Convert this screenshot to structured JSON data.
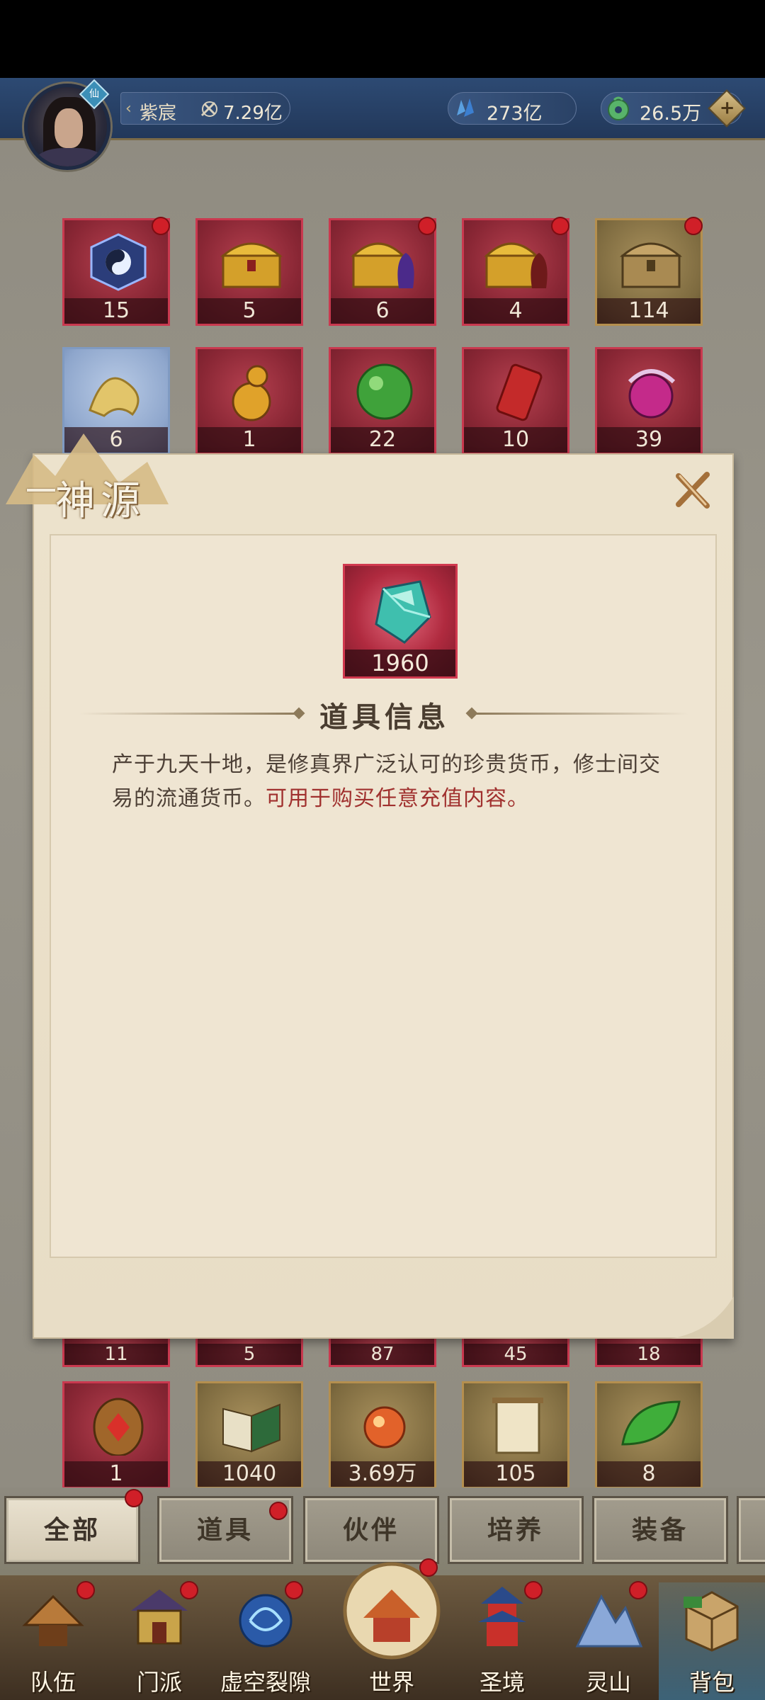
{
  "player": {
    "name": "紫宸",
    "vip_badge": "仙",
    "power": "7.29亿"
  },
  "currencies": [
    {
      "icon": "crystal-icon",
      "value": "273亿"
    },
    {
      "icon": "jade-coin-icon",
      "value": "26.5万"
    }
  ],
  "grid": {
    "row1": [
      {
        "count": "15",
        "icon": "bagua-orb-icon",
        "style": "red",
        "dot": true
      },
      {
        "count": "5",
        "icon": "golden-chest-icon",
        "style": "red",
        "dot": false
      },
      {
        "count": "6",
        "icon": "golden-chest-purple-icon",
        "style": "red",
        "dot": true
      },
      {
        "count": "4",
        "icon": "golden-chest-red-icon",
        "style": "red",
        "dot": true
      },
      {
        "count": "114",
        "icon": "bronze-chest-icon",
        "style": "gold",
        "dot": true
      }
    ],
    "row2": [
      {
        "count": "6",
        "icon": "golden-dragon-icon",
        "style": "blue"
      },
      {
        "count": "1",
        "icon": "gourd-bottle-icon",
        "style": "red"
      },
      {
        "count": "22",
        "icon": "green-pearl-icon",
        "style": "red"
      },
      {
        "count": "10",
        "icon": "red-talisman-icon",
        "style": "red"
      },
      {
        "count": "39",
        "icon": "purple-orb-icon",
        "style": "red"
      }
    ],
    "row3_partial": [
      "11",
      "5",
      "87",
      "45",
      "18"
    ],
    "row4": [
      {
        "count": "1",
        "icon": "bronze-token-icon",
        "style": "red"
      },
      {
        "count": "1040",
        "icon": "book-icon",
        "style": "gold"
      },
      {
        "count": "3.69万",
        "icon": "fire-orb-icon",
        "style": "gold"
      },
      {
        "count": "105",
        "icon": "scroll-icon",
        "style": "gold"
      },
      {
        "count": "8",
        "icon": "green-leaf-icon",
        "style": "gold"
      }
    ]
  },
  "dialog": {
    "title": "神源",
    "item_count": "1960",
    "section_title": "道具信息",
    "description": "产于九天十地，是修真界广泛认可的珍贵货币，修士间交易的流通货币。",
    "description_highlight": "可用于购买任意充值内容。"
  },
  "tabs": [
    {
      "label": "全部",
      "active": true,
      "dot": true
    },
    {
      "label": "道具",
      "active": false,
      "dot": true
    },
    {
      "label": "伙伴",
      "active": false,
      "dot": false
    },
    {
      "label": "培养",
      "active": false,
      "dot": false
    },
    {
      "label": "装备",
      "active": false,
      "dot": false
    }
  ],
  "nav": [
    {
      "label": "队伍",
      "icon": "hat-icon",
      "dot": true
    },
    {
      "label": "门派",
      "icon": "sect-gate-icon",
      "dot": true
    },
    {
      "label": "虚空裂隙",
      "icon": "void-rift-icon",
      "dot": true
    },
    {
      "label": "世界",
      "icon": "world-palace-icon",
      "dot": true
    },
    {
      "label": "圣境",
      "icon": "pagoda-icon",
      "dot": true
    },
    {
      "label": "灵山",
      "icon": "mountain-icon",
      "dot": true
    },
    {
      "label": "背包",
      "icon": "backpack-icon",
      "dot": false
    }
  ],
  "colors": {
    "accent_red": "#c9394f",
    "highlight_text": "#a0302e",
    "topbar": "#2d4a73"
  }
}
